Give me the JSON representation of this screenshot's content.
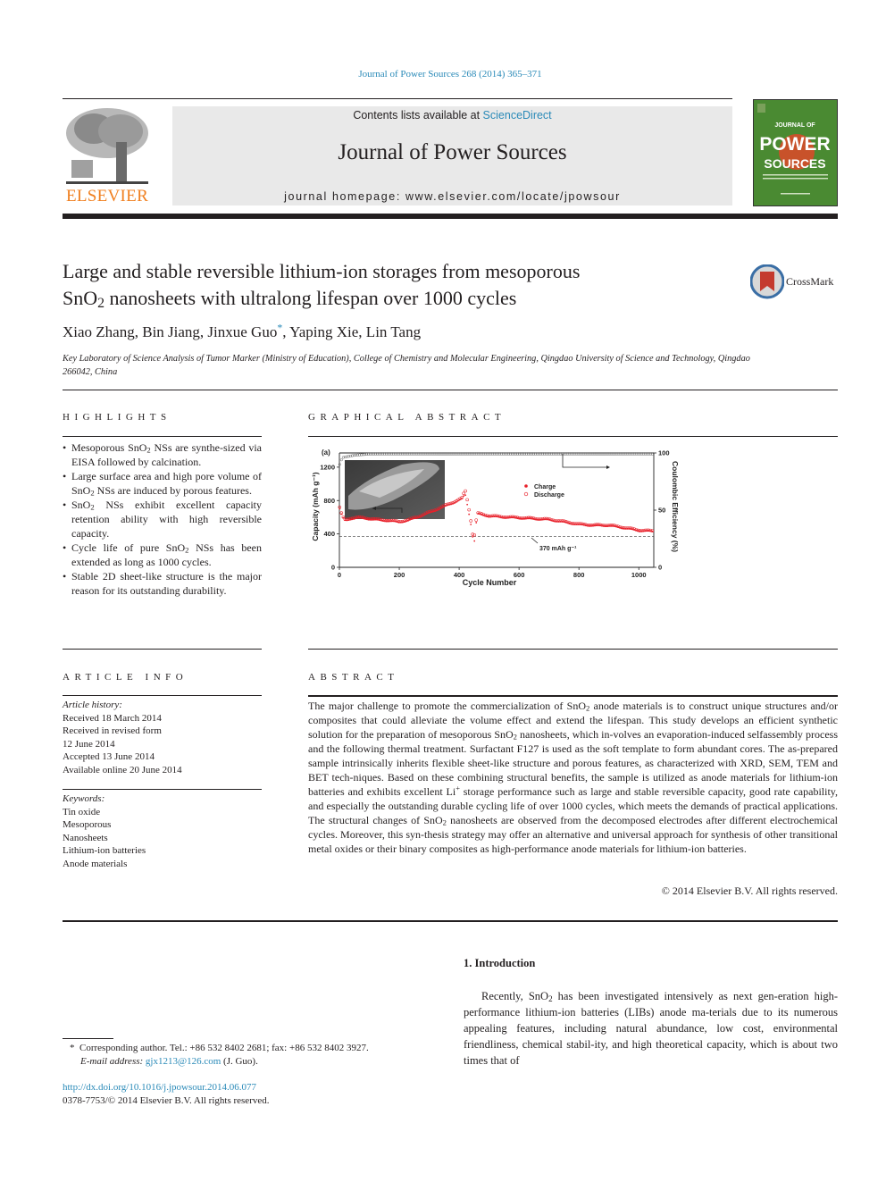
{
  "header": {
    "journal_ref": "Journal of Power Sources 268 (2014) 365–371",
    "contents_prefix": "Contents lists available at ",
    "contents_link": "ScienceDirect",
    "journal_title": "Journal of Power Sources",
    "homepage_prefix": "journal homepage: ",
    "homepage_url": "www.elsevier.com/locate/jpowsour",
    "publisher": "ELSEVIER",
    "cover_label_top": "JOURNAL OF",
    "cover_label_mid": "POWER",
    "cover_label_bot": "SOURCES",
    "colors": {
      "link": "#2a8ab8",
      "elsevier_orange": "#f07f1f",
      "cover_green": "#4a8a32",
      "cover_orange": "#c8522a"
    }
  },
  "article": {
    "title_line1": "Large and stable reversible lithium-ion storages from mesoporous",
    "title_line2_pre": "SnO",
    "title_line2_sub": "2",
    "title_line2_post": " nanosheets with ultralong lifespan over 1000 cycles",
    "crossmark_label": "CrossMark",
    "authors_pre": "Xiao Zhang, Bin Jiang, Jinxue Guo",
    "authors_mark": "*",
    "authors_post": ", Yaping Xie, Lin Tang",
    "affiliation": "Key Laboratory of Science Analysis of Tumor Marker (Ministry of Education), College of Chemistry and Molecular Engineering, Qingdao University of Science and Technology, Qingdao 266042, China"
  },
  "highlights": {
    "heading": "HIGHLIGHTS",
    "items": [
      {
        "pre": "Mesoporous SnO",
        "sub": "2",
        "post": " NSs are synthe-sized via EISA followed by calcination."
      },
      {
        "pre": "Large surface area and high pore volume of SnO",
        "sub": "2",
        "post": " NSs are induced by porous features."
      },
      {
        "pre": "SnO",
        "sub": "2",
        "post": " NSs exhibit excellent capacity retention ability with high reversible capacity."
      },
      {
        "pre": "Cycle life of pure SnO",
        "sub": "2",
        "post": " NSs has been extended as long as 1000 cycles."
      },
      {
        "pre": "Stable 2D sheet-like structure is the major reason for its outstanding durability.",
        "sub": "",
        "post": ""
      }
    ]
  },
  "graphical_abstract": {
    "heading": "GRAPHICAL ABSTRACT"
  },
  "chart_data": {
    "type": "scatter",
    "panel_label": "(a)",
    "title": "",
    "xlabel": "Cycle Number",
    "ylabel": "Capacity (mAh g⁻¹)",
    "y2label": "Coulombic Efficiency (%)",
    "xlim": [
      0,
      1050
    ],
    "ylim": [
      0,
      1370
    ],
    "y2lim": [
      0,
      100
    ],
    "xticks": [
      0,
      200,
      400,
      600,
      800,
      1000
    ],
    "yticks": [
      0,
      400,
      800,
      1200
    ],
    "y2ticks": [
      0,
      50,
      100
    ],
    "grid": false,
    "legend": {
      "placement": "center-right",
      "entries": [
        "Charge",
        "Discharge"
      ]
    },
    "annotation": "370 mAh g⁻¹",
    "reference_line": 370,
    "inset": "SEM image of SnO2 nanosheet",
    "series": [
      {
        "name": "Charge",
        "axis": "left",
        "color": "#e8202a",
        "x": [
          1,
          10,
          20,
          40,
          60,
          80,
          100,
          130,
          160,
          200,
          230,
          260,
          300,
          340,
          380,
          410,
          420,
          430,
          440,
          445,
          450,
          460,
          500,
          550,
          600,
          650,
          700,
          750,
          800,
          850,
          900,
          950,
          1000,
          1050
        ],
        "y": [
          700,
          600,
          555,
          580,
          590,
          585,
          580,
          565,
          560,
          540,
          560,
          595,
          650,
          710,
          770,
          820,
          880,
          700,
          500,
          370,
          280,
          640,
          610,
          600,
          590,
          580,
          570,
          540,
          510,
          500,
          500,
          470,
          440,
          430
        ]
      },
      {
        "name": "Discharge",
        "axis": "left",
        "color": "#e8202a",
        "x": [
          1,
          10,
          20,
          40,
          60,
          80,
          100,
          130,
          160,
          200,
          230,
          260,
          300,
          340,
          380,
          410,
          420,
          430,
          440,
          445,
          450,
          460,
          500,
          550,
          600,
          650,
          700,
          750,
          800,
          850,
          900,
          950,
          1000,
          1050
        ],
        "y": [
          720,
          610,
          565,
          590,
          600,
          592,
          585,
          572,
          565,
          548,
          568,
          605,
          660,
          720,
          780,
          830,
          930,
          760,
          540,
          400,
          360,
          650,
          618,
          605,
          596,
          586,
          576,
          548,
          518,
          506,
          506,
          478,
          446,
          436
        ]
      },
      {
        "name": "Coulombic Efficiency",
        "axis": "right",
        "color": "#555555",
        "x": [
          1,
          10,
          50,
          100,
          200,
          300,
          400,
          500,
          600,
          700,
          800,
          900,
          1000,
          1050
        ],
        "y": [
          90,
          96,
          98,
          99,
          99,
          99,
          99,
          99,
          99,
          99,
          99,
          99,
          99,
          99
        ]
      }
    ]
  },
  "article_info": {
    "heading": "ARTICLE INFO",
    "history_label": "Article history:",
    "history": [
      "Received 18 March 2014",
      "Received in revised form",
      "12 June 2014",
      "Accepted 13 June 2014",
      "Available online 20 June 2014"
    ],
    "keywords_label": "Keywords:",
    "keywords": [
      "Tin oxide",
      "Mesoporous",
      "Nanosheets",
      "Lithium-ion batteries",
      "Anode materials"
    ]
  },
  "abstract": {
    "heading": "ABSTRACT",
    "p1": "The major challenge to promote the commercialization of SnO",
    "p2": " anode materials is to construct unique structures and/or composites that could alleviate the volume effect and extend the lifespan. This study develops an efficient synthetic solution for the preparation of mesoporous SnO",
    "p3": " nanosheets, which in-volves an evaporation-induced selfassembly process and the following thermal treatment. Surfactant F127 is used as the soft template to form abundant cores. The as-prepared sample intrinsically inherits flexible sheet-like structure and porous features, as characterized with XRD, SEM, TEM and BET tech-niques. Based on these combining structural benefits, the sample is utilized as anode materials for lithium-ion batteries and exhibits excellent Li",
    "p3_sup": "+",
    "p4": " storage performance such as large and stable reversible capacity, good rate capability, and especially the outstanding durable cycling life of over 1000 cycles, which meets the demands of practical applications. The structural changes of SnO",
    "p5": " nanosheets are observed from the decomposed electrodes after different electrochemical cycles. Moreover, this syn-thesis strategy may offer an alternative and universal approach for synthesis of other transitional metal oxides or their binary composites as high-performance anode materials for lithium-ion batteries.",
    "sub": "2",
    "copyright": "© 2014 Elsevier B.V. All rights reserved."
  },
  "introduction": {
    "heading": "1.  Introduction",
    "text_pre": "Recently, SnO",
    "text_sub": "2",
    "text_post": " has been investigated intensively as next gen-eration high-performance lithium-ion batteries (LIBs) anode ma-terials due to its numerous appealing features, including natural abundance, low cost, environmental friendliness, chemical stabil-ity, and high theoretical capacity, which is about two times that of"
  },
  "footnotes": {
    "corr_mark": "*",
    "corr_text": "Corresponding author. Tel.: +86 532 8402 2681; fax: +86 532 8402 3927.",
    "email_label": "E-mail address: ",
    "email": "gjx1213@126.com",
    "email_suffix": " (J. Guo).",
    "doi": "http://dx.doi.org/10.1016/j.jpowsour.2014.06.077",
    "issn": "0378-7753/© 2014 Elsevier B.V. All rights reserved."
  }
}
